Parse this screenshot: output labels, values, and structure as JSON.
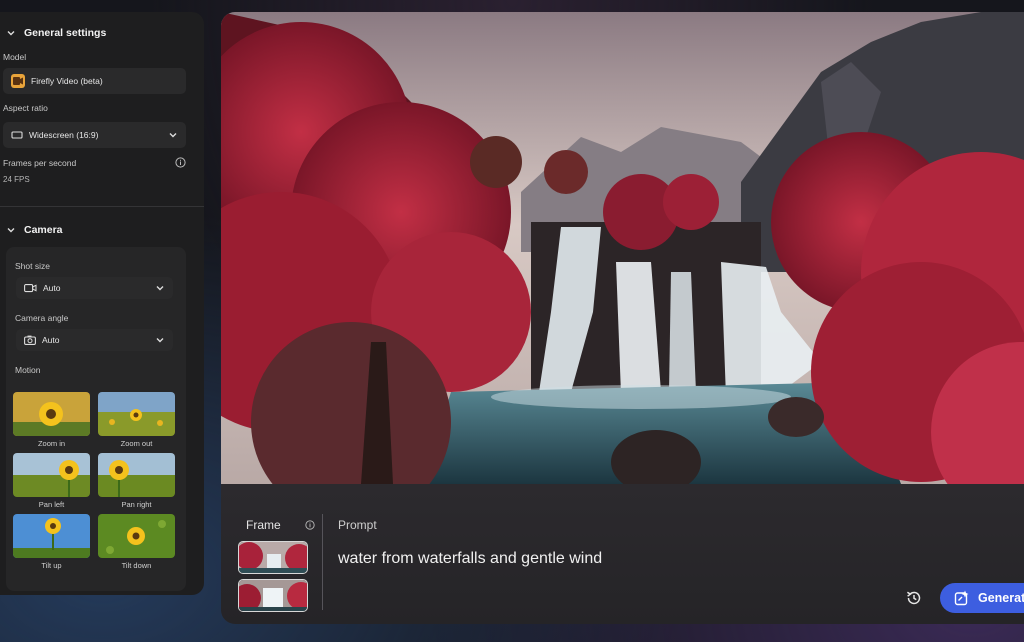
{
  "general": {
    "section_title": "General settings",
    "model_label": "Model",
    "model_value": "Firefly Video (beta)",
    "aspect_label": "Aspect ratio",
    "aspect_value": "Widescreen (16:9)",
    "fps_label": "Frames per second",
    "fps_value": "24 FPS"
  },
  "camera": {
    "section_title": "Camera",
    "shot_size_label": "Shot size",
    "shot_size_value": "Auto",
    "angle_label": "Camera angle",
    "angle_value": "Auto",
    "motion_label": "Motion",
    "motions": [
      "Zoom in",
      "Zoom out",
      "Pan left",
      "Pan right",
      "Tilt up",
      "Tilt down"
    ]
  },
  "prompt_bar": {
    "frame_label": "Frame",
    "prompt_label": "Prompt",
    "prompt_text": "water from waterfalls and gentle wind",
    "generate_label": "Generate"
  },
  "colors": {
    "accent": "#3d5ee0",
    "panel": "#1e1e1f",
    "foliage": "#b3243a"
  },
  "icons": [
    "chevron-down-icon",
    "info-icon",
    "video-camera-icon",
    "camera-icon",
    "history-icon",
    "generate-sparkle-icon"
  ]
}
